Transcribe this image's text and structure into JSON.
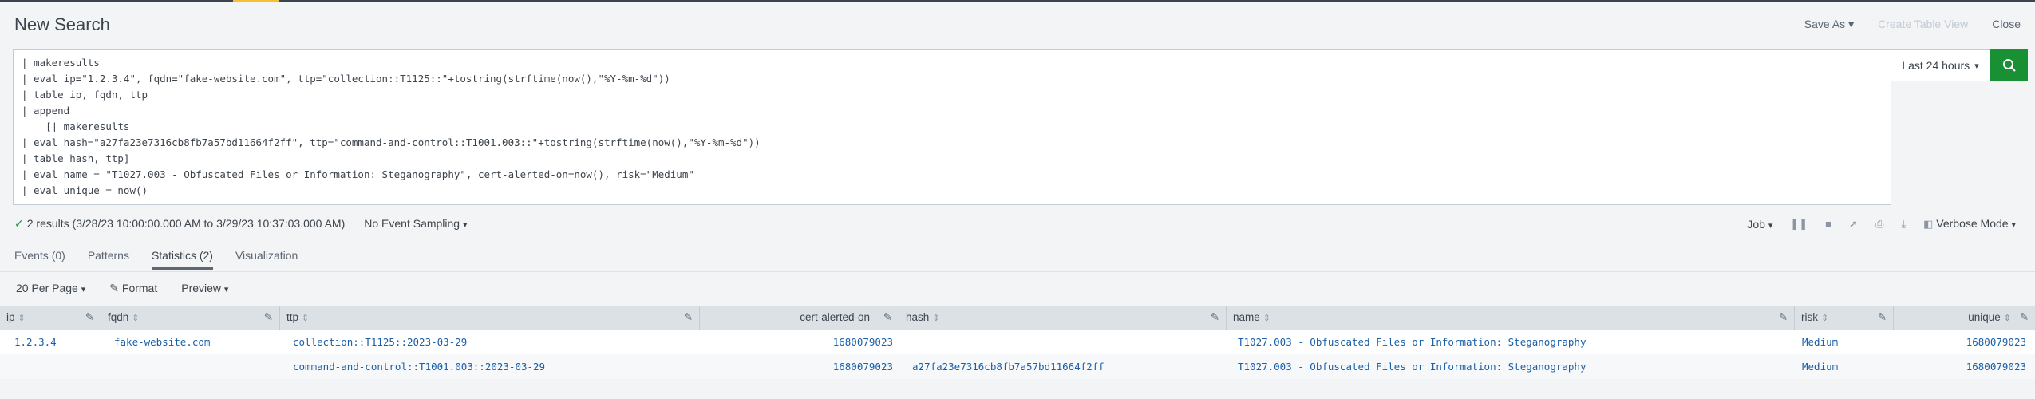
{
  "header": {
    "title": "New Search",
    "save_as": "Save As",
    "create_table_view": "Create Table View",
    "close": "Close"
  },
  "search": {
    "lines": [
      "| makeresults",
      "| eval ip=\"1.2.3.4\", fqdn=\"fake-website.com\", ttp=\"collection::T1125::\"+tostring(strftime(now(),\"%Y-%m-%d\"))",
      "| table ip, fqdn, ttp",
      "| append",
      "    [| makeresults",
      "| eval hash=\"a27fa23e7316cb8fb7a57bd11664f2ff\", ttp=\"command-and-control::T1001.003::\"+tostring(strftime(now(),\"%Y-%m-%d\"))",
      "| table hash, ttp]",
      "| eval name = \"T1027.003 - Obfuscated Files or Information: Steganography\", cert-alerted-on=now(), risk=\"Medium\"",
      "| eval unique = now()"
    ],
    "time_range": "Last 24 hours"
  },
  "status": {
    "results": "2 results (3/28/23 10:00:00.000 AM to 3/29/23 10:37:03.000 AM)",
    "sampling": "No Event Sampling",
    "job": "Job",
    "mode": "Verbose Mode"
  },
  "tabs": [
    {
      "label": "Events (0)"
    },
    {
      "label": "Patterns"
    },
    {
      "label": "Statistics (2)"
    },
    {
      "label": "Visualization"
    }
  ],
  "toolbar": {
    "per_page": "20 Per Page",
    "format": "Format",
    "preview": "Preview"
  },
  "table": {
    "columns": [
      "ip",
      "fqdn",
      "ttp",
      "cert-alerted-on",
      "hash",
      "name",
      "risk",
      "unique"
    ],
    "rows": [
      {
        "ip": "1.2.3.4",
        "fqdn": "fake-website.com",
        "ttp": "collection::T1125::2023-03-29",
        "cert": "1680079023",
        "hash": "",
        "name": "T1027.003 - Obfuscated Files or Information: Steganography",
        "risk": "Medium",
        "unique": "1680079023"
      },
      {
        "ip": "",
        "fqdn": "",
        "ttp": "command-and-control::T1001.003::2023-03-29",
        "cert": "1680079023",
        "hash": "a27fa23e7316cb8fb7a57bd11664f2ff",
        "name": "T1027.003 - Obfuscated Files or Information: Steganography",
        "risk": "Medium",
        "unique": "1680079023"
      }
    ]
  },
  "colors": {
    "accent": "#f8be34",
    "search_button": "#1a9035",
    "link": "#1a5fa8",
    "keyword": "#2662fc",
    "function": "#b1009c"
  },
  "icons": {
    "search": "search-icon",
    "check": "check-icon",
    "edit": "pencil-icon",
    "sort": "sort-icon"
  }
}
